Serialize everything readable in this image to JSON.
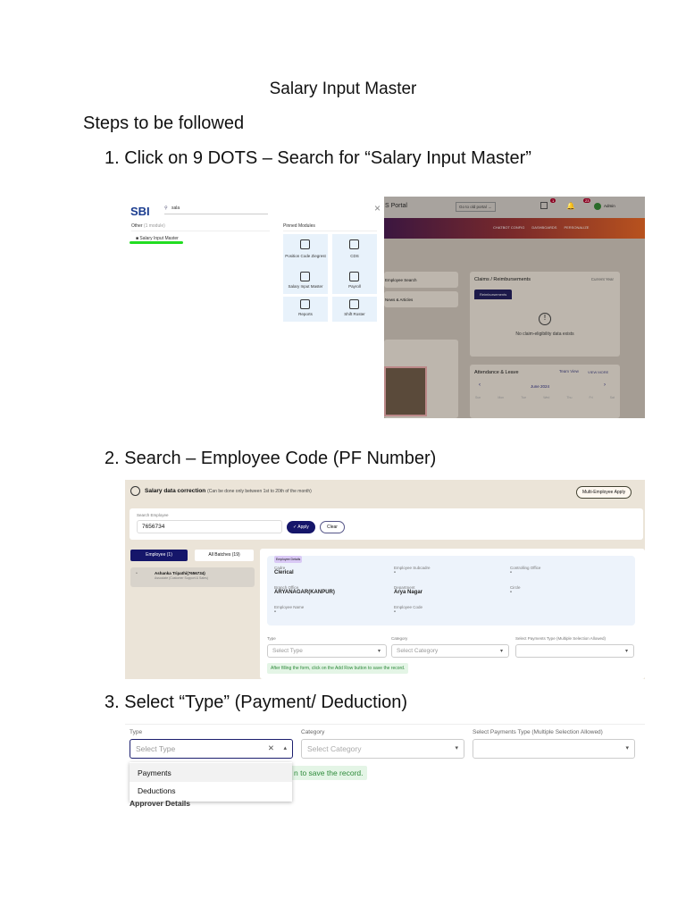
{
  "title": "Salary Input Master",
  "steps_heading": "Steps to be followed",
  "steps": [
    "1. Click on 9 DOTS – Search for “Salary Input Master”",
    "2. Search – Employee Code (PF Number)",
    "3. Select “Type” (Payment/ Deduction)"
  ],
  "shot1": {
    "logo": "SBI",
    "search_value": "sala",
    "other_label": "Other",
    "other_count": "(1 module)",
    "result": "Salary Input Master",
    "pinned_heading": "Pinned Modules",
    "pinned": [
      "Position Code Ziegrest",
      "CDS",
      "Salary Input Master",
      "Payroll",
      "Reports",
      "Shift Roster"
    ],
    "portal_title": "S Portal",
    "old_portal": "Go to old portal →",
    "badge1": "1",
    "badge2": "23",
    "admin": "Admin",
    "nav": [
      "CHATBOT CONFIG",
      "DASHBOARDS",
      "PERSONALIZE"
    ],
    "side": [
      "Employee Search",
      "News & Articles"
    ],
    "claims_title": "Claims / Reimbursements",
    "claims_period": "Current Year",
    "claims_tab": "Reimbursements",
    "claims_empty": "No claim-eligibility data exists",
    "att_title": "Attendance & Leave",
    "team_view": "Team View",
    "view_more": "VIEW MORE",
    "month": "June 2024",
    "days": [
      "Sun",
      "Mon",
      "Tue",
      "Wed",
      "Thu",
      "Fri",
      "Sat"
    ]
  },
  "shot2": {
    "title": "Salary data correction",
    "subtitle": "(Can be done only between 1st to 20th of the month)",
    "multi_apply": "Multi-Employee Apply",
    "search_label": "Search Employee",
    "search_value": "7656734",
    "apply": "✓ Apply",
    "clear": "Clear",
    "tab_employee": "Employee (1)",
    "tab_batches": "All Batches (19)",
    "emp_name": "Ashanka Tripathi(7656734)",
    "emp_role": "Associate (Customer Support & Sales)",
    "details_badge": "Employee Details",
    "fields": [
      {
        "label": "Cadre",
        "value": "Clerical"
      },
      {
        "label": "Employee Subcadre",
        "value": "-"
      },
      {
        "label": "Controlling Office",
        "value": "-"
      },
      {
        "label": "Branch Office",
        "value": "ARYANAGAR(KANPUR)"
      },
      {
        "label": "Department",
        "value": "Arya Nagar"
      },
      {
        "label": "Circle",
        "value": "-"
      },
      {
        "label": "Employee Name",
        "value": "-"
      },
      {
        "label": "Employee Code",
        "value": "-"
      }
    ],
    "type_label": "Type",
    "type_ph": "Select Type",
    "cat_label": "Category",
    "cat_ph": "Select Category",
    "pay_label": "Select Payments Type (Multiple Selection Allowed)",
    "info": "After filling the form, click on the Add Row button to save the record."
  },
  "shot3": {
    "type_label": "Type",
    "type_ph": "Select Type",
    "cat_label": "Category",
    "cat_ph": "Select Category",
    "pay_label": "Select Payments Type (Multiple Selection Allowed)",
    "options": [
      "Payments",
      "Deductions"
    ],
    "info_partial": "n to save the record.",
    "approver": "Approver Details"
  }
}
